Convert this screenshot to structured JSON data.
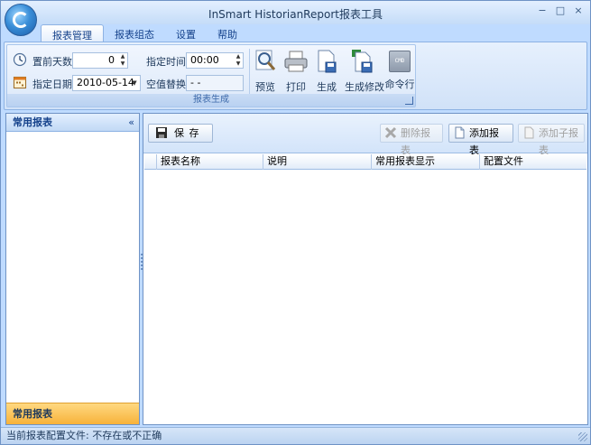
{
  "window": {
    "title": "InSmart HistorianReport报表工具",
    "controls": {
      "minimize": "−",
      "restore": "□",
      "close": "×"
    }
  },
  "ribbon": {
    "tabs": [
      {
        "label": "报表管理",
        "active": true
      },
      {
        "label": "报表组态",
        "active": false
      },
      {
        "label": "设置",
        "active": false
      },
      {
        "label": "帮助",
        "active": false
      }
    ],
    "group_caption": "报表生成",
    "days_before_label": "置前天数",
    "days_before_value": "0",
    "date_label": "指定日期",
    "date_value": "2010-05-14",
    "time_label": "指定时间",
    "time_value": "00:00",
    "null_replace_label": "空值替换",
    "null_replace_value": "- -",
    "buttons": {
      "preview": "预览",
      "print": "打印",
      "generate": "生成",
      "generate_modify": "生成修改",
      "command": "命令行"
    },
    "cmd_icon_text": "CMD"
  },
  "left_pane": {
    "header": "常用报表",
    "collapse_glyph": "«",
    "footer": "常用报表"
  },
  "toolbar": {
    "save": "保 存",
    "delete_report": "删除报表",
    "add_report": "添加报表",
    "add_sub_report": "添加子报表"
  },
  "grid": {
    "columns": [
      "报表名称",
      "说明",
      "常用报表显示",
      "配置文件"
    ]
  },
  "statusbar": {
    "text": "当前报表配置文件: 不存在或不正确"
  },
  "colors": {
    "accent": "#15428b",
    "footer_highlight": "#f7b23a"
  }
}
